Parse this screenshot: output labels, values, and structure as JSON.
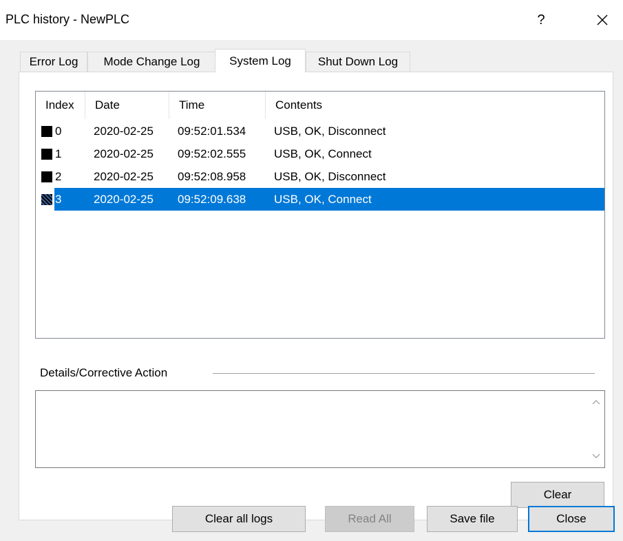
{
  "window": {
    "title": "PLC history - NewPLC",
    "help_glyph": "?"
  },
  "tabs": [
    {
      "label": "Error Log"
    },
    {
      "label": "Mode Change Log"
    },
    {
      "label": "System Log",
      "active": true
    },
    {
      "label": "Shut Down Log"
    }
  ],
  "table": {
    "columns": [
      "Index",
      "Date",
      "Time",
      "Contents"
    ],
    "rows": [
      {
        "index": "0",
        "date": "2020-02-25",
        "time": "09:52:01.534",
        "contents": "USB, OK, Disconnect"
      },
      {
        "index": "1",
        "date": "2020-02-25",
        "time": "09:52:02.555",
        "contents": "USB, OK, Connect"
      },
      {
        "index": "2",
        "date": "2020-02-25",
        "time": "09:52:08.958",
        "contents": "USB, OK, Disconnect"
      },
      {
        "index": "3",
        "date": "2020-02-25",
        "time": "09:52:09.638",
        "contents": "USB, OK, Connect",
        "selected": true
      }
    ]
  },
  "details": {
    "label": "Details/Corrective Action",
    "value": ""
  },
  "buttons": {
    "clear": "Clear",
    "clear_all_logs": "Clear all logs",
    "read_all": "Read All",
    "save_file": "Save file",
    "close": "Close"
  },
  "colors": {
    "selection": "#0078d7",
    "dialog_bg": "#f0f0f0"
  }
}
